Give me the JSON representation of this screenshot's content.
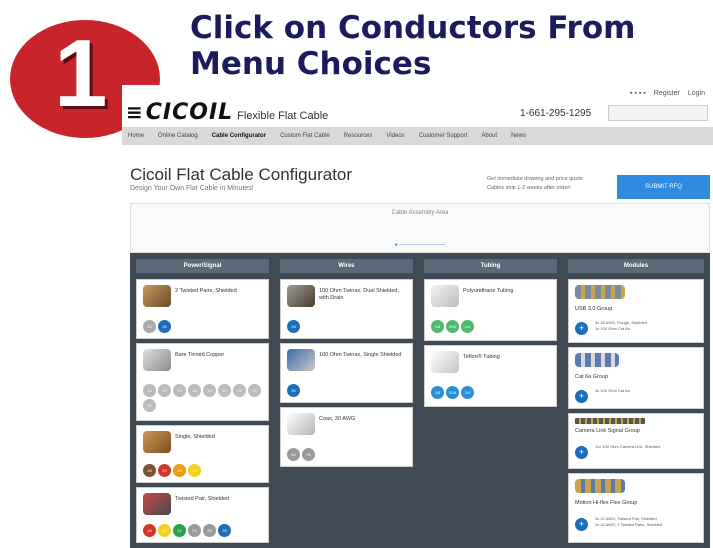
{
  "instruction": {
    "step": "1",
    "text": "Click on Conductors From Menu Choices"
  },
  "site": {
    "logo": "CICOIL",
    "logo_sub": "Flexible Flat Cable",
    "phone": "1-661-295-1295",
    "top_links": [
      "Register",
      "Login"
    ],
    "nav": [
      "Home",
      "Online Catalog",
      "Cable Configurator",
      "Custom Flat Cable",
      "Resources",
      "Videos",
      "Customer Support",
      "About",
      "News"
    ]
  },
  "configurator": {
    "title": "Cicoil Flat Cable Configurator",
    "subtitle": "Design Your Own Flat Cable in Minutes!",
    "bullets": [
      "Get immediate drawing and price quote",
      "Cables ship 1-2 weeks after order!"
    ],
    "quote_button": "SUBMIT RFQ",
    "assembly_title": "Cable Assembly Area",
    "columns": [
      "Power/Signal",
      "Wires",
      "Tubing",
      "Modules"
    ],
    "power_cards": [
      {
        "title": "2 Twisted Pairs, Shielded",
        "dots": [
          "20",
          "26"
        ]
      },
      {
        "title": "Bare Tinned Copper",
        "dots": [
          "10",
          "12",
          "14",
          "16",
          "18",
          "20",
          "22",
          "24",
          "26"
        ]
      },
      {
        "title": "Single, Shielded",
        "dots": [
          "18",
          "20",
          "22",
          "24"
        ]
      },
      {
        "title": "Twisted Pair, Shielded",
        "dots": [
          "18",
          "20",
          "22",
          "24",
          "26",
          "28"
        ]
      }
    ],
    "wire_cards": [
      {
        "title": "100 Ohm Twinax, Dual Shielded, with Drain",
        "dots": [
          "28"
        ]
      },
      {
        "title": "100 Ohm Twinax, Single Shielded",
        "dots": [
          "30"
        ]
      },
      {
        "title": "Coax, 30 AWG",
        "dots": [
          "50",
          "75"
        ]
      }
    ],
    "tubing_cards": [
      {
        "title": "Polyurethane Tubing",
        "dots": [
          "1/8",
          "3/16",
          "1/4"
        ]
      },
      {
        "title": "Teflon® Tubing",
        "dots": [
          "1/8",
          "3/16",
          "1/4"
        ]
      }
    ],
    "module_cards": [
      {
        "title": "USB 3.0 Group",
        "bullets": [
          "3x 28 AWG, Rough, Shielded",
          "1x 100 Ohm Cat 6a"
        ]
      },
      {
        "title": "Cat 6a Group",
        "bullets": [
          "4x 100 Ohm Cat 6a"
        ]
      },
      {
        "title": "Camera Link Signal Group",
        "bullets": [
          "11x 100 Ohm Camera Link, Shielded"
        ]
      },
      {
        "title": "Motion Hi-flex Flex Group",
        "bullets": [
          "3x 22 AWG, Twisted Pair, Shielded",
          "2x 22 AWG, 2 Twisted Pairs, Shielded"
        ]
      }
    ]
  }
}
